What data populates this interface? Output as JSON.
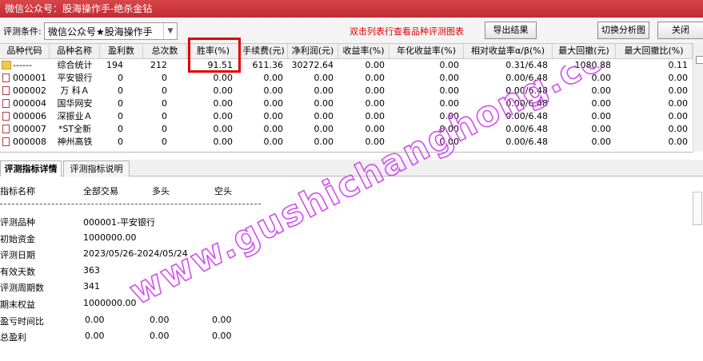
{
  "window": {
    "title": "微信公众号：股海操作手-绝杀金钻"
  },
  "toolbar": {
    "condition_label": "评测条件:",
    "condition_value": "微信公众号★股海操作手",
    "hint": "双击列表行查看品种评测图表",
    "export_label": "导出结果",
    "switch_label": "切换分析图",
    "close_label": "关闭"
  },
  "table": {
    "headers": [
      "品种代码",
      "品种名称",
      "盈利数",
      "总次数",
      "胜率(%)",
      "手续费(元)",
      "净利润(元)",
      "收益率(%)",
      "年化收益率(%)",
      "相对收益率α/β(%)",
      "最大回撤(元)",
      "最大回撤比(%)"
    ],
    "rows": [
      [
        "------",
        "综合统计",
        "194",
        "212",
        "91.51",
        "611.36",
        "30272.64",
        "0.00",
        "0.00",
        "0.31/6.48",
        "1080.88",
        "0.11"
      ],
      [
        "000001",
        "平安银行",
        "0",
        "0",
        "0.00",
        "0.00",
        "0.00",
        "0.00",
        "0.00",
        "0.00/6.48",
        "0.00",
        "0.00"
      ],
      [
        "000002",
        "万 科Ａ",
        "0",
        "0",
        "0.00",
        "0.00",
        "0.00",
        "0.00",
        "0.00",
        "0.00/6.48",
        "0.00",
        "0.00"
      ],
      [
        "000004",
        "国华网安",
        "0",
        "0",
        "0.00",
        "0.00",
        "0.00",
        "0.00",
        "0.00",
        "0.00/6.48",
        "0.00",
        "0.00"
      ],
      [
        "000006",
        "深振业Ａ",
        "0",
        "0",
        "0.00",
        "0.00",
        "0.00",
        "0.00",
        "0.00",
        "0.00/6.48",
        "0.00",
        "0.00"
      ],
      [
        "000007",
        "*ST全新",
        "0",
        "0",
        "0.00",
        "0.00",
        "0.00",
        "0.00",
        "0.00",
        "0.00/6.48",
        "0.00",
        "0.00"
      ],
      [
        "000008",
        "神州高铁",
        "0",
        "0",
        "0.00",
        "0.00",
        "0.00",
        "0.00",
        "0.00",
        "0.00/6.48",
        "0.00",
        "0.00"
      ]
    ]
  },
  "tabs": [
    "评测指标详情",
    "评测指标说明"
  ],
  "detail": {
    "header": [
      "指标名称",
      "全部交易",
      "多头",
      "空头"
    ],
    "items": [
      {
        "label": "评测品种",
        "v1": "000001-平安银行"
      },
      {
        "label": "初始资金",
        "v1": "1000000.00"
      },
      {
        "label": "评测日期",
        "v1": "2023/05/26-2024/05/24"
      },
      {
        "label": "有效天数",
        "v1": "363"
      },
      {
        "label": "评测周期数",
        "v1": "341"
      },
      {
        "label": "期末权益",
        "v1": "1000000.00"
      },
      {
        "label": "盈亏时间比",
        "v1": "0.00",
        "v2": "0.00",
        "v3": "0.00"
      },
      {
        "label": "总盈利",
        "v1": "0.00",
        "v2": "0.00",
        "v3": "0.00"
      }
    ]
  },
  "watermark": {
    "text": "www.gushichanghong.com",
    "color": "#d24ef0"
  }
}
